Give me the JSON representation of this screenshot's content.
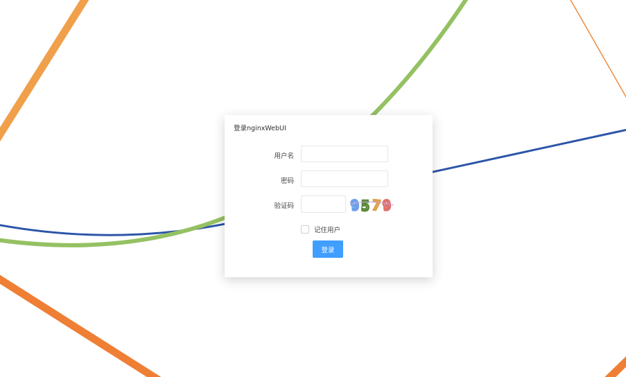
{
  "login": {
    "title": "登录nginxWebUI",
    "username_label": "用户名",
    "username_value": "",
    "password_label": "密码",
    "password_value": "",
    "captcha_label": "验证码",
    "captcha_value": "",
    "captcha_text": "9579",
    "remember_label": "记住用户",
    "remember_checked": false,
    "submit_label": "登录"
  },
  "colors": {
    "accent": "#409eff",
    "bg_line_orange": "#f0913a",
    "bg_line_green": "#92c060",
    "bg_line_blue": "#2c55a8"
  }
}
